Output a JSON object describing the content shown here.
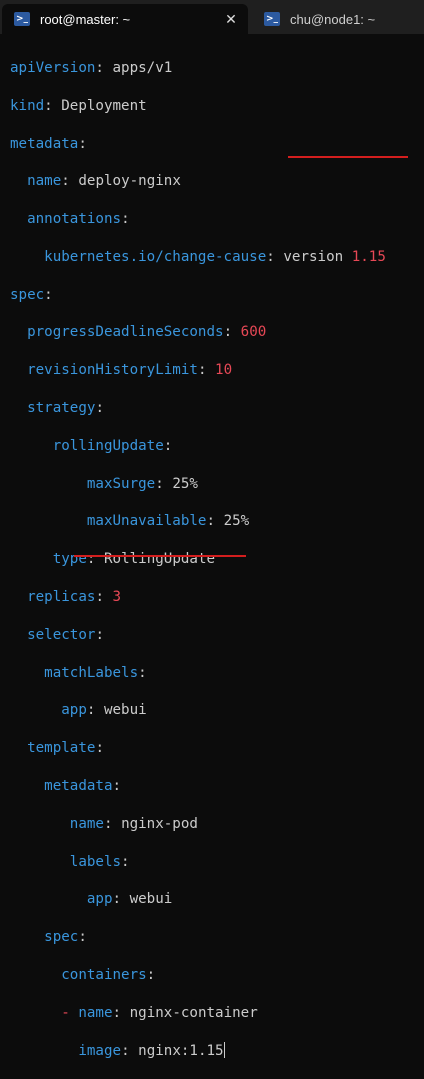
{
  "tabs": [
    {
      "title": "root@master: ~",
      "icon": "powershell-icon",
      "close": "✕"
    },
    {
      "title": "chu@node1: ~",
      "icon": "powershell-icon"
    }
  ],
  "yaml": {
    "apiVersion_key": "apiVersion",
    "apiVersion_val": "apps/v1",
    "kind_key": "kind",
    "kind_val": "Deployment",
    "metadata_key": "metadata",
    "name_key": "name",
    "name_val": "deploy-nginx",
    "annotations_key": "annotations",
    "change_cause_key": "kubernetes.io/change-cause",
    "change_cause_text": "version",
    "change_cause_num": "1.15",
    "spec_key": "spec",
    "pds_key": "progressDeadlineSeconds",
    "pds_val": "600",
    "rhl_key": "revisionHistoryLimit",
    "rhl_val": "10",
    "strategy_key": "strategy",
    "rolling_key": "rollingUpdate",
    "maxsurge_key": "maxSurge",
    "maxsurge_val": "25%",
    "maxunavail_key": "maxUnavailable",
    "maxunavail_val": "25%",
    "type_key": "type",
    "type_val": "RollingUpdate",
    "replicas_key": "replicas",
    "replicas_val": "3",
    "selector_key": "selector",
    "matchlabels_key": "matchLabels",
    "app_key": "app",
    "app_val": "webui",
    "template_key": "template",
    "tmeta_key": "metadata",
    "tname_key": "name",
    "tname_val": "nginx-pod",
    "labels_key": "labels",
    "tapp_key": "app",
    "tapp_val": "webui",
    "tspec_key": "spec",
    "containers_key": "containers",
    "dash": "-",
    "cname_key": "name",
    "cname_val": "nginx-container",
    "image_key": "image",
    "image_val": "nginx:1.15"
  },
  "colors": {
    "key": "#3a96dd",
    "number": "#e74856",
    "text": "#cccccc",
    "underline": "#d41e1e",
    "background": "#0c0c0c"
  }
}
